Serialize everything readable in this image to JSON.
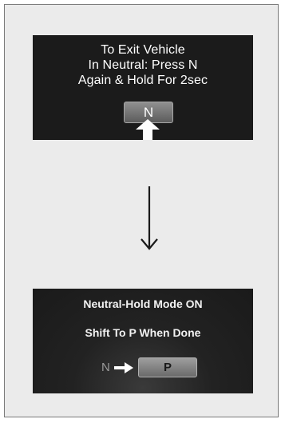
{
  "top_screen": {
    "line1": "To Exit Vehicle",
    "line2": "In Neutral: Press N",
    "line3": "Again & Hold For 2sec",
    "button_label": "N"
  },
  "bottom_screen": {
    "line1": "Neutral-Hold Mode ON",
    "line2": "Shift To P When Done",
    "from_gear": "N",
    "to_gear": "P"
  },
  "icons": {
    "press": "up-arrow-icon",
    "transition": "down-arrow-icon",
    "shift": "right-arrow-icon"
  },
  "colors": {
    "screen_bg": "#1b1b1b",
    "panel_bg": "#ebebeb",
    "button_gray": "#7a7a7a",
    "text": "#ffffff"
  }
}
